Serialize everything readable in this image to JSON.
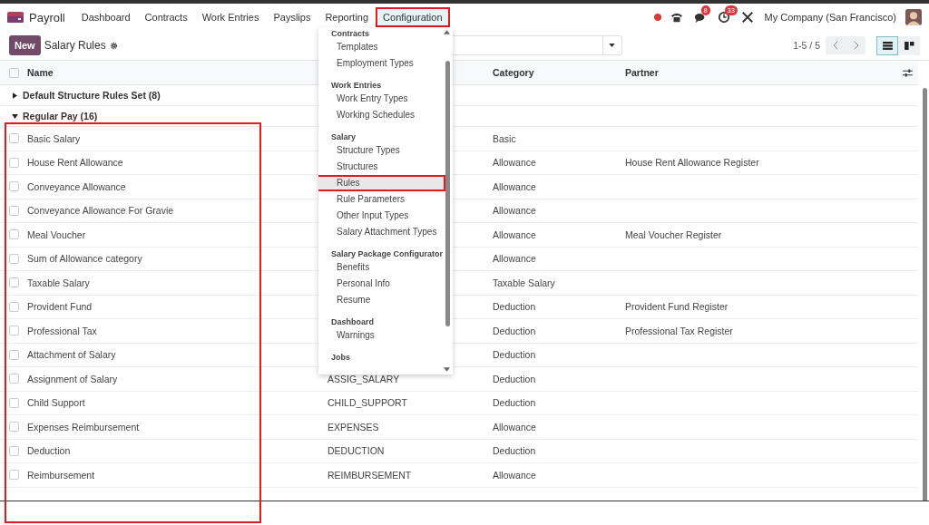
{
  "app": {
    "name": "Payroll"
  },
  "menu": [
    {
      "label": "Dashboard",
      "highlighted": false
    },
    {
      "label": "Contracts",
      "highlighted": false
    },
    {
      "label": "Work Entries",
      "highlighted": false
    },
    {
      "label": "Payslips",
      "highlighted": false
    },
    {
      "label": "Reporting",
      "highlighted": false
    },
    {
      "label": "Configuration",
      "highlighted": true
    }
  ],
  "systray": {
    "recording": true,
    "messages_badge": "8",
    "activities_badge": "33",
    "company": "My Company (San Francisco)"
  },
  "control_panel": {
    "new_button": "New",
    "title": "Salary Rules",
    "pager": "1-5 / 5",
    "views": [
      {
        "kind": "list",
        "selected": true
      },
      {
        "kind": "kanban",
        "selected": false
      }
    ]
  },
  "table": {
    "columns": [
      {
        "label": "Name"
      },
      {
        "label": "Category"
      },
      {
        "label": "Partner"
      }
    ],
    "select_all_checked": false,
    "name_column_highlighted": true,
    "groups": [
      {
        "label": "Default Structure Rules Set (8)",
        "expanded": false
      },
      {
        "label": "Regular Pay (16)",
        "expanded": true,
        "rows": [
          {
            "checked": false,
            "name": "Basic Salary",
            "category": "Basic"
          },
          {
            "checked": false,
            "name": "House Rent Allowance",
            "category": "Allowance",
            "partner": "House Rent Allowance Register"
          },
          {
            "checked": false,
            "name": "Conveyance Allowance",
            "category": "Allowance"
          },
          {
            "checked": false,
            "name": "Conveyance Allowance For Gravie",
            "category": "Allowance"
          },
          {
            "checked": false,
            "name": "Meal Voucher",
            "category": "Allowance",
            "partner": "Meal Voucher Register"
          },
          {
            "checked": false,
            "name": "Sum of Allowance category",
            "category": "Allowance"
          },
          {
            "checked": false,
            "name": "Taxable Salary",
            "category": "Taxable Salary"
          },
          {
            "checked": false,
            "name": "Provident Fund",
            "category": "Deduction",
            "partner": "Provident Fund Register"
          },
          {
            "checked": false,
            "name": "Professional Tax",
            "category": "Deduction",
            "partner": "Professional Tax Register"
          },
          {
            "checked": false,
            "name": "Attachment of Salary",
            "category": "Deduction"
          },
          {
            "checked": false,
            "name": "Assignment of Salary",
            "code": "ASSIG_SALARY",
            "category": "Deduction"
          },
          {
            "checked": false,
            "name": "Child Support",
            "code": "CHILD_SUPPORT",
            "category": "Deduction"
          },
          {
            "checked": false,
            "name": "Expenses Reimbursement",
            "code": "EXPENSES",
            "category": "Allowance"
          },
          {
            "checked": false,
            "name": "Deduction",
            "code": "DEDUCTION",
            "category": "Deduction"
          },
          {
            "checked": false,
            "name": "Reimbursement",
            "code": "REIMBURSEMENT",
            "category": "Allowance"
          }
        ]
      }
    ]
  },
  "dropdown": {
    "sections": [
      {
        "header": "Contracts",
        "items": [
          {
            "label": "Templates",
            "highlighted": false
          },
          {
            "label": "Employment Types",
            "highlighted": false
          }
        ]
      },
      {
        "header": "Work Entries",
        "items": [
          {
            "label": "Work Entry Types",
            "highlighted": false
          },
          {
            "label": "Working Schedules",
            "highlighted": false
          }
        ]
      },
      {
        "header": "Salary",
        "items": [
          {
            "label": "Structure Types",
            "highlighted": false
          },
          {
            "label": "Structures",
            "highlighted": false
          },
          {
            "label": "Rules",
            "highlighted": true
          },
          {
            "label": "Rule Parameters",
            "highlighted": false
          },
          {
            "label": "Other Input Types",
            "highlighted": false
          },
          {
            "label": "Salary Attachment Types",
            "highlighted": false
          }
        ]
      },
      {
        "header": "Salary Package Configurator",
        "items": [
          {
            "label": "Benefits",
            "highlighted": false
          },
          {
            "label": "Personal Info",
            "highlighted": false
          },
          {
            "label": "Resume",
            "highlighted": false
          }
        ]
      },
      {
        "header": "Dashboard",
        "items": [
          {
            "label": "Warnings",
            "highlighted": false
          }
        ]
      },
      {
        "header": "Jobs"
      }
    ]
  }
}
